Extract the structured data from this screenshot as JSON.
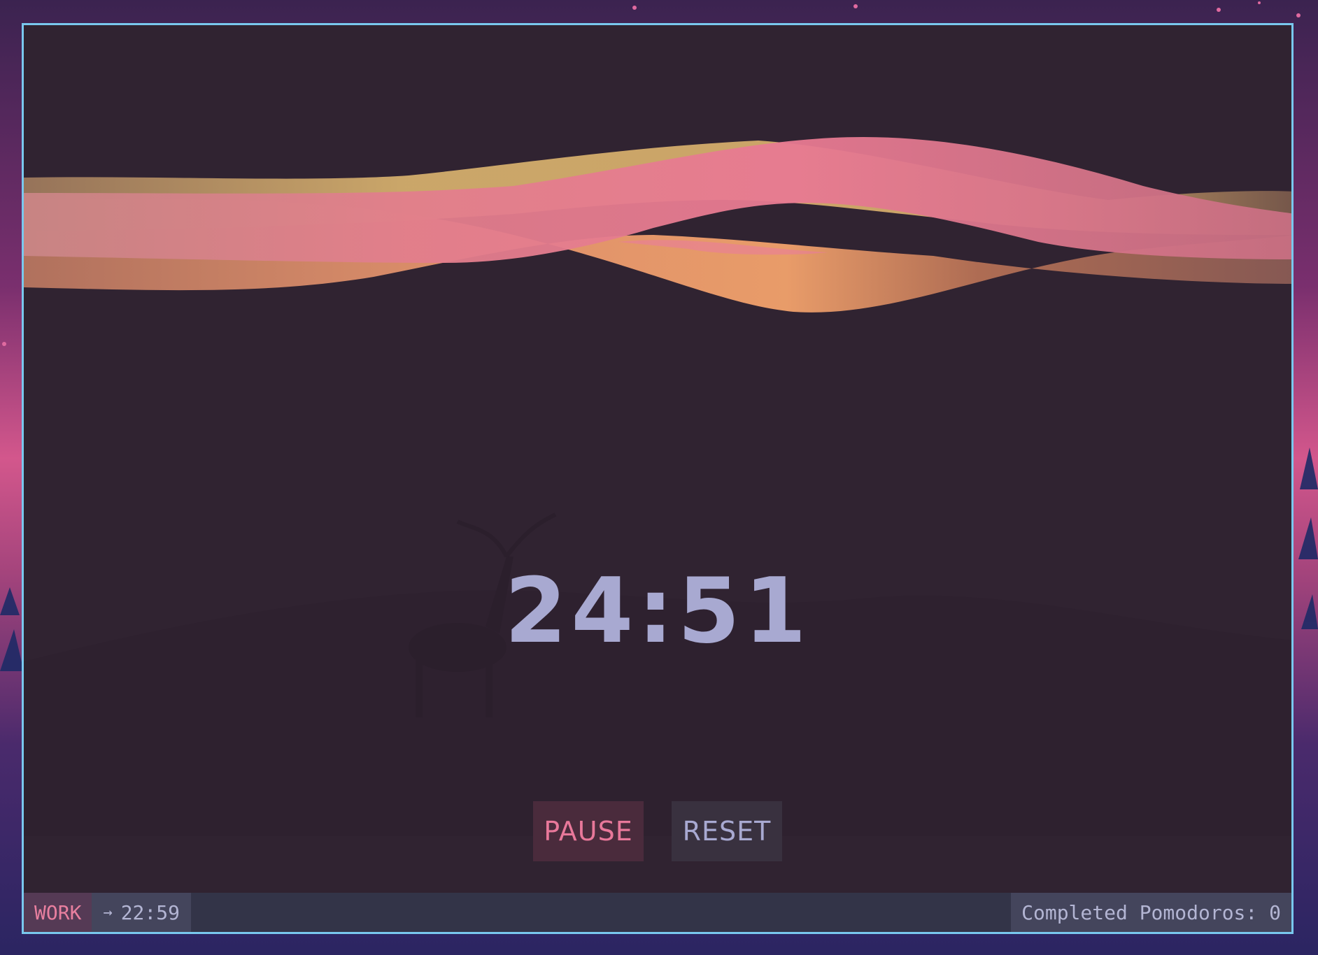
{
  "timer": {
    "display": "24:51"
  },
  "controls": {
    "pause_label": "PAUSE",
    "reset_label": "RESET"
  },
  "statusbar": {
    "mode": "WORK",
    "next_arrow": "→",
    "next_time": "22:59",
    "completed_label": "Completed Pomodoros: 0"
  },
  "colors": {
    "frame_border": "#79c8ee",
    "window_bg": "#302331",
    "timer_text": "#a8a9d1",
    "accent_pink": "#e8789a",
    "aurora_orange": "#f0a070",
    "aurora_gold": "#d8b06c",
    "aurora_pink": "#e67892"
  }
}
